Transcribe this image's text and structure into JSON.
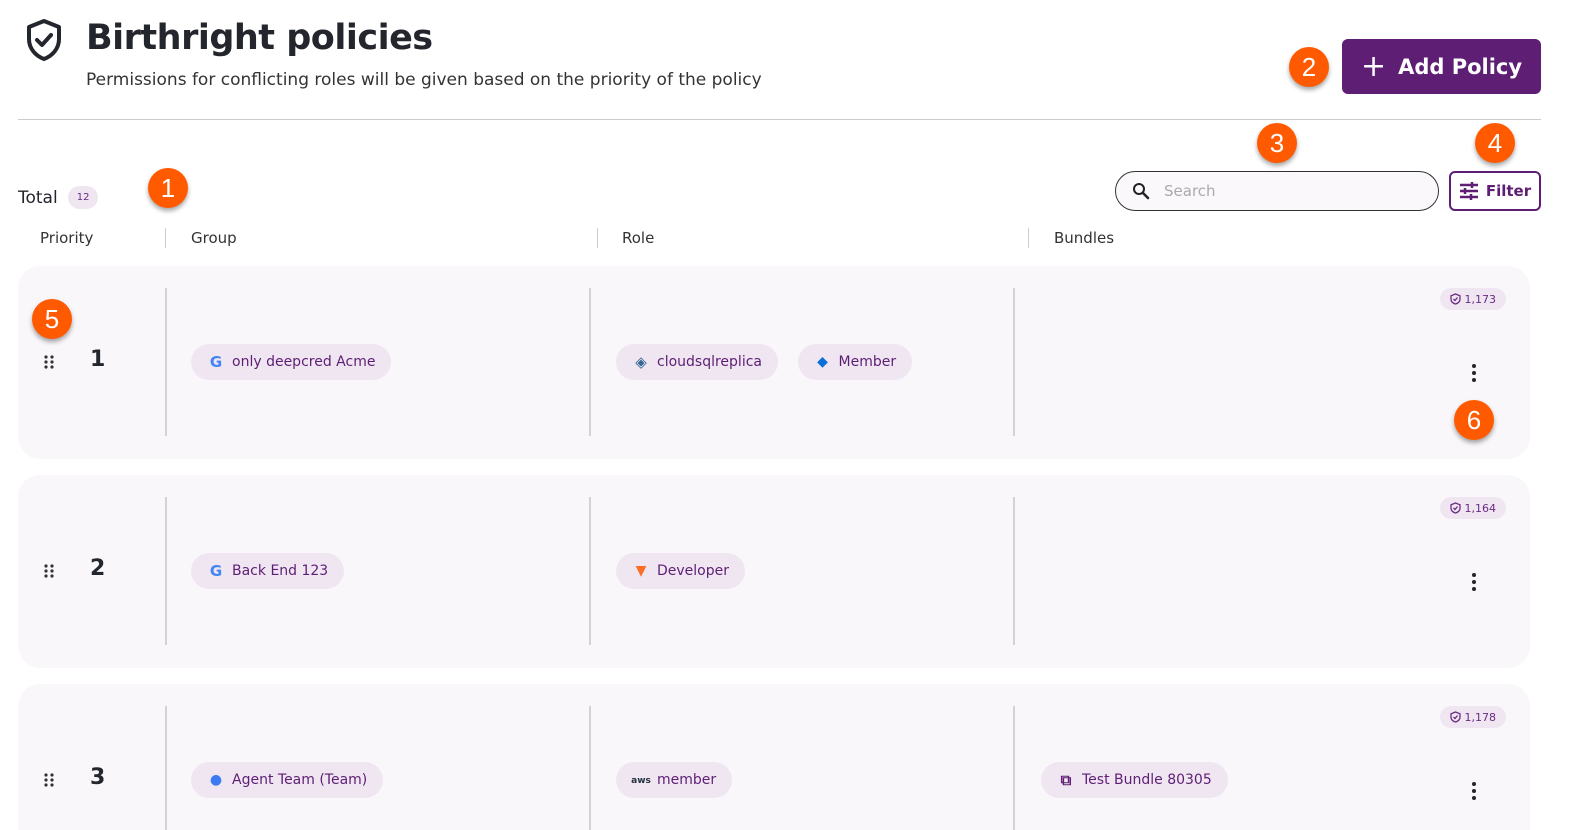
{
  "header": {
    "title": "Birthright policies",
    "subtitle": "Permissions for conflicting roles will be given based on the priority of the policy",
    "add_button": "Add Policy"
  },
  "toolbar": {
    "total_label": "Total",
    "total_count": "12",
    "search_placeholder": "Search",
    "filter_label": "Filter"
  },
  "columns": [
    "Priority",
    "Group",
    "Role",
    "Bundles"
  ],
  "rows": [
    {
      "priority": "1",
      "group": {
        "label": "only deepcred Acme",
        "icon": "google-icon"
      },
      "roles": [
        {
          "label": "cloudsqlreplica",
          "icon": "postgresql-icon"
        },
        {
          "label": "Member",
          "icon": "azure-icon"
        }
      ],
      "bundles": [],
      "badge": "1,173"
    },
    {
      "priority": "2",
      "group": {
        "label": "Back End 123",
        "icon": "google-icon"
      },
      "roles": [
        {
          "label": "Developer",
          "icon": "gitlab-icon"
        }
      ],
      "bundles": [],
      "badge": "1,164"
    },
    {
      "priority": "3",
      "group": {
        "label": "Agent Team (Team)",
        "icon": "person-icon"
      },
      "roles": [
        {
          "label": "member",
          "icon": "aws-icon"
        }
      ],
      "bundles": [
        {
          "label": "Test Bundle 80305",
          "icon": "bundle-icon"
        }
      ],
      "badge": "1,178"
    }
  ],
  "annotations": [
    "1",
    "2",
    "3",
    "4",
    "5",
    "6"
  ],
  "colors": {
    "accent": "#5e1e74",
    "chip_bg": "#efe6f2",
    "annotation": "#ff5a00",
    "card_bg": "#f9f7fa"
  }
}
